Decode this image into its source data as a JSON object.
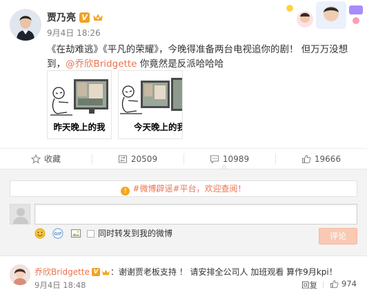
{
  "post": {
    "author": "贾乃亮",
    "verified_badge": "V",
    "time": "9月4日 18:26",
    "text_before_mention": "《在劫难逃》《平凡的荣耀》，今晚得准备两台电视追你的剧！ 但万万没想到，",
    "mention": "@乔欣Bridgette",
    "text_after_mention": " 你竟然是反派哈哈哈",
    "memes": [
      {
        "caption": "昨天晚上的我"
      },
      {
        "caption": "今天晚上的我"
      }
    ]
  },
  "actions": {
    "collect_label": "收藏",
    "repost_count": "20509",
    "comment_count": "10989",
    "like_count": "19666"
  },
  "comment_box": {
    "notice_prefix": "#微博辟谣#平台，",
    "notice_link": "欢迎查阅！",
    "input_value": "",
    "repost_option": "同时转发到我的微博",
    "submit_label": "评论"
  },
  "comment": {
    "author": "乔欣Bridgette",
    "text": "：谢谢贾老板支持 ！ 请安排全公司人 加班观看 算作9月kpi！",
    "time": "9月4日 18:48",
    "reply_label": "回复",
    "like_count": "974"
  },
  "icons": {
    "crown": "crown-icon",
    "collect": "star-icon",
    "repost": "repost-icon",
    "comment": "comment-icon",
    "like": "thumbs-up-icon",
    "emoji": "emoji-icon",
    "gif": "gif-icon",
    "image": "image-icon"
  },
  "colors": {
    "accent": "#eb7350",
    "verified": "#f0a224",
    "submit_disabled": "#f9c9b4"
  }
}
